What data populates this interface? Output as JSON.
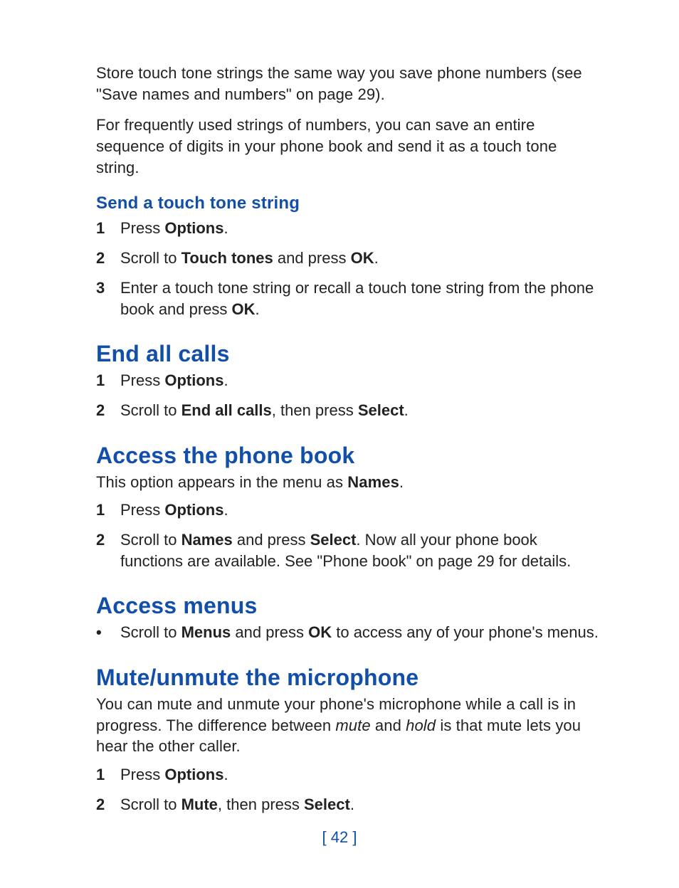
{
  "intro": {
    "p1_a": "Store touch tone strings the same way you save phone numbers (see \"Save names and numbers\" on page 29).",
    "p2_a": "For frequently used strings of numbers, you can save an entire sequence of digits in your phone book and send it as a touch tone string."
  },
  "section_send": {
    "title": "Send a touch tone string",
    "steps": [
      {
        "n": "1",
        "pre": "Press ",
        "b1": "Options",
        "post": "."
      },
      {
        "n": "2",
        "pre": "Scroll to ",
        "b1": "Touch tones",
        "mid": " and press ",
        "b2": "OK",
        "post": "."
      },
      {
        "n": "3",
        "pre": "Enter a touch tone string or recall a touch tone string from the phone book and press ",
        "b1": "OK",
        "post": "."
      }
    ]
  },
  "section_end": {
    "title": "End all calls",
    "steps": [
      {
        "n": "1",
        "pre": "Press ",
        "b1": "Options",
        "post": "."
      },
      {
        "n": "2",
        "pre": "Scroll to ",
        "b1": "End all calls",
        "mid": ", then press ",
        "b2": "Select",
        "post": "."
      }
    ]
  },
  "section_phonebook": {
    "title": "Access the phone book",
    "intro_pre": "This option appears in the menu as ",
    "intro_b": "Names",
    "intro_post": ".",
    "steps": [
      {
        "n": "1",
        "pre": "Press ",
        "b1": "Options",
        "post": "."
      },
      {
        "n": "2",
        "pre": "Scroll to ",
        "b1": "Names",
        "mid": " and press ",
        "b2": "Select",
        "post": ". Now all your phone book functions are available. See \"Phone book\" on page 29 for details."
      }
    ]
  },
  "section_menus": {
    "title": "Access menus",
    "bullet_pre": "Scroll to ",
    "bullet_b1": "Menus",
    "bullet_mid": " and press ",
    "bullet_b2": "OK",
    "bullet_post": " to access any of your phone's menus.",
    "dot": "•"
  },
  "section_mute": {
    "title": "Mute/unmute the microphone",
    "intro_a": "You can mute and unmute your phone's microphone while a call is in progress. The difference between ",
    "intro_i1": "mute",
    "intro_b": " and ",
    "intro_i2": "hold",
    "intro_c": " is that mute lets you hear the other caller.",
    "steps": [
      {
        "n": "1",
        "pre": "Press ",
        "b1": "Options",
        "post": "."
      },
      {
        "n": "2",
        "pre": "Scroll to ",
        "b1": "Mute",
        "mid": ", then press ",
        "b2": "Select",
        "post": "."
      }
    ]
  },
  "page_number": "[ 42 ]"
}
